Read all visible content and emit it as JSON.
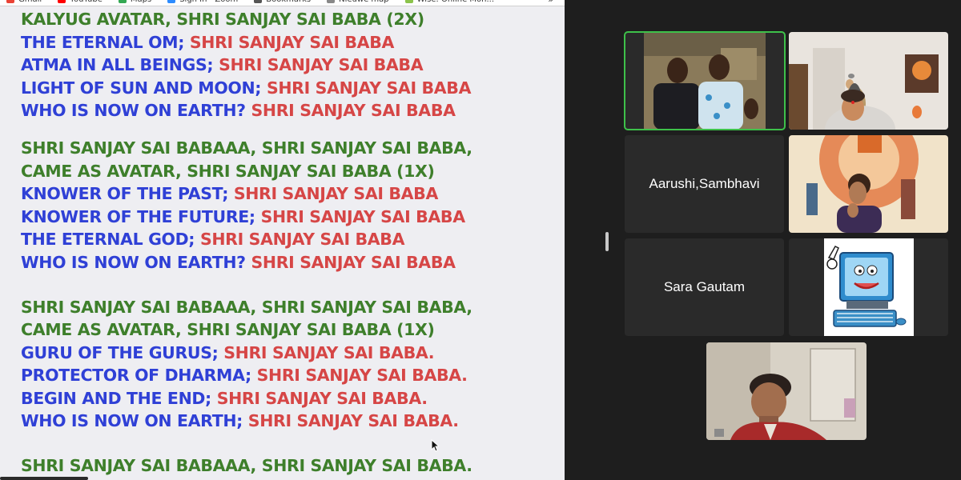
{
  "browser": {
    "bookmarks": [
      {
        "label": "Gmail",
        "color": "#ea4335"
      },
      {
        "label": "YouTube",
        "color": "#ff0000"
      },
      {
        "label": "Maps",
        "color": "#34a853"
      },
      {
        "label": "Sign In - Zoom",
        "color": "#2d8cff"
      },
      {
        "label": "Bookmarks",
        "color": "#555555"
      },
      {
        "label": "Nieuwe map",
        "color": "#888888"
      },
      {
        "label": "Wise: Online Mon...",
        "color": "#8bc34a"
      }
    ],
    "overflow": "»"
  },
  "lyrics": {
    "stanzas": [
      {
        "lines": [
          [
            {
              "text": "KALYUG AVATAR, SHRI SANJAY SAI BABA (2X)",
              "color": "green"
            }
          ],
          [
            {
              "text": "THE ETERNAL OM; ",
              "color": "blue"
            },
            {
              "text": "SHRI SANJAY SAI BABA",
              "color": "red"
            }
          ],
          [
            {
              "text": "ATMA IN ALL BEINGS; ",
              "color": "blue"
            },
            {
              "text": "SHRI SANJAY SAI BABA",
              "color": "red"
            }
          ],
          [
            {
              "text": "LIGHT OF SUN AND MOON; ",
              "color": "blue"
            },
            {
              "text": "SHRI SANJAY SAI BABA",
              "color": "red"
            }
          ],
          [
            {
              "text": "WHO IS NOW ON EARTH? ",
              "color": "blue"
            },
            {
              "text": "SHRI SANJAY SAI BABA",
              "color": "red"
            }
          ]
        ]
      },
      {
        "lines": [
          [
            {
              "text": "SHRI SANJAY SAI BABAAA, SHRI SANJAY SAI BABA,",
              "color": "green"
            }
          ],
          [
            {
              "text": "CAME AS AVATAR, SHRI SANJAY SAI BABA (1X)",
              "color": "green"
            }
          ],
          [
            {
              "text": "KNOWER OF THE PAST; ",
              "color": "blue"
            },
            {
              "text": "SHRI SANJAY SAI BABA",
              "color": "red"
            }
          ],
          [
            {
              "text": "KNOWER OF THE FUTURE; ",
              "color": "blue"
            },
            {
              "text": "SHRI SANJAY SAI BABA",
              "color": "red"
            }
          ],
          [
            {
              "text": "THE ETERNAL GOD; ",
              "color": "blue"
            },
            {
              "text": "SHRI SANJAY SAI BABA",
              "color": "red"
            }
          ],
          [
            {
              "text": "WHO IS NOW ON EARTH? ",
              "color": "blue"
            },
            {
              "text": "SHRI SANJAY SAI BABA",
              "color": "red"
            }
          ]
        ]
      },
      {
        "lines": [
          [
            {
              "text": "SHRI SANJAY SAI BABAAA, SHRI SANJAY SAI BABA,",
              "color": "green"
            }
          ],
          [
            {
              "text": "CAME AS AVATAR, SHRI SANJAY SAI BABA (1X)",
              "color": "green"
            }
          ],
          [
            {
              "text": "GURU OF THE GURUS; ",
              "color": "blue"
            },
            {
              "text": "SHRI SANJAY SAI BABA.",
              "color": "red"
            }
          ],
          [
            {
              "text": "PROTECTOR OF DHARMA; ",
              "color": "blue"
            },
            {
              "text": "SHRI SANJAY SAI BABA.",
              "color": "red"
            }
          ],
          [
            {
              "text": "BEGIN AND THE END; ",
              "color": "blue"
            },
            {
              "text": "SHRI SANJAY SAI BABA.",
              "color": "red"
            }
          ],
          [
            {
              "text": "WHO IS NOW ON EARTH; ",
              "color": "blue"
            },
            {
              "text": "SHRI SANJAY SAI BABA.",
              "color": "red"
            }
          ]
        ]
      },
      {
        "lines": [
          [
            {
              "text": "SHRI SANJAY SAI BABAAA, SHRI SANJAY SAI BABA.",
              "color": "green"
            }
          ]
        ]
      }
    ]
  },
  "colors": {
    "green": "#3e7f2b",
    "blue": "#2f40d6",
    "red": "#d64646",
    "active_speaker": "#3ec14a",
    "tile_bg": "#2a2a2a",
    "screen_bg": "#eeeef2"
  },
  "participants": [
    {
      "name": "",
      "video": "two-men-video",
      "active": true
    },
    {
      "name": "",
      "video": "woman-red-bindi-video",
      "active": false
    },
    {
      "name": "Aarushi,Sambhavi",
      "video": "",
      "active": false
    },
    {
      "name": "",
      "video": "woman-with-banner-video",
      "active": false
    },
    {
      "name": "Sara Gautam",
      "video": "",
      "active": false
    },
    {
      "name": "",
      "video": "cartoon-computer-avatar",
      "active": false
    },
    {
      "name": "",
      "video": "man-red-sweater-video",
      "active": false
    }
  ]
}
